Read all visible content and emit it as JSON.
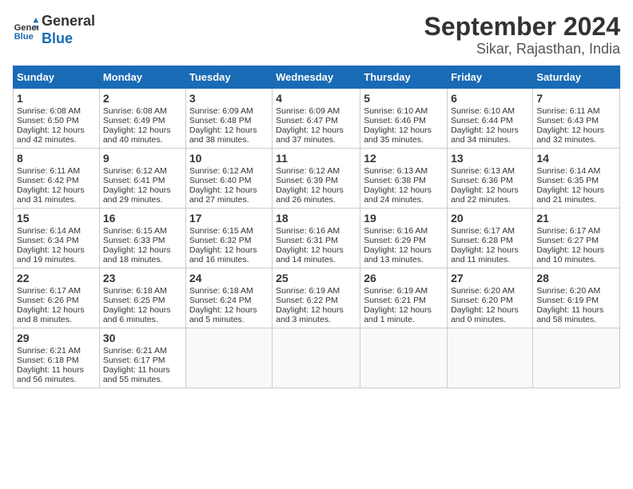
{
  "header": {
    "logo_line1": "General",
    "logo_line2": "Blue",
    "title": "September 2024",
    "subtitle": "Sikar, Rajasthan, India"
  },
  "days_of_week": [
    "Sunday",
    "Monday",
    "Tuesday",
    "Wednesday",
    "Thursday",
    "Friday",
    "Saturday"
  ],
  "weeks": [
    [
      {
        "day": "1",
        "sunrise": "Sunrise: 6:08 AM",
        "sunset": "Sunset: 6:50 PM",
        "daylight": "Daylight: 12 hours and 42 minutes."
      },
      {
        "day": "2",
        "sunrise": "Sunrise: 6:08 AM",
        "sunset": "Sunset: 6:49 PM",
        "daylight": "Daylight: 12 hours and 40 minutes."
      },
      {
        "day": "3",
        "sunrise": "Sunrise: 6:09 AM",
        "sunset": "Sunset: 6:48 PM",
        "daylight": "Daylight: 12 hours and 38 minutes."
      },
      {
        "day": "4",
        "sunrise": "Sunrise: 6:09 AM",
        "sunset": "Sunset: 6:47 PM",
        "daylight": "Daylight: 12 hours and 37 minutes."
      },
      {
        "day": "5",
        "sunrise": "Sunrise: 6:10 AM",
        "sunset": "Sunset: 6:46 PM",
        "daylight": "Daylight: 12 hours and 35 minutes."
      },
      {
        "day": "6",
        "sunrise": "Sunrise: 6:10 AM",
        "sunset": "Sunset: 6:44 PM",
        "daylight": "Daylight: 12 hours and 34 minutes."
      },
      {
        "day": "7",
        "sunrise": "Sunrise: 6:11 AM",
        "sunset": "Sunset: 6:43 PM",
        "daylight": "Daylight: 12 hours and 32 minutes."
      }
    ],
    [
      {
        "day": "8",
        "sunrise": "Sunrise: 6:11 AM",
        "sunset": "Sunset: 6:42 PM",
        "daylight": "Daylight: 12 hours and 31 minutes."
      },
      {
        "day": "9",
        "sunrise": "Sunrise: 6:12 AM",
        "sunset": "Sunset: 6:41 PM",
        "daylight": "Daylight: 12 hours and 29 minutes."
      },
      {
        "day": "10",
        "sunrise": "Sunrise: 6:12 AM",
        "sunset": "Sunset: 6:40 PM",
        "daylight": "Daylight: 12 hours and 27 minutes."
      },
      {
        "day": "11",
        "sunrise": "Sunrise: 6:12 AM",
        "sunset": "Sunset: 6:39 PM",
        "daylight": "Daylight: 12 hours and 26 minutes."
      },
      {
        "day": "12",
        "sunrise": "Sunrise: 6:13 AM",
        "sunset": "Sunset: 6:38 PM",
        "daylight": "Daylight: 12 hours and 24 minutes."
      },
      {
        "day": "13",
        "sunrise": "Sunrise: 6:13 AM",
        "sunset": "Sunset: 6:36 PM",
        "daylight": "Daylight: 12 hours and 22 minutes."
      },
      {
        "day": "14",
        "sunrise": "Sunrise: 6:14 AM",
        "sunset": "Sunset: 6:35 PM",
        "daylight": "Daylight: 12 hours and 21 minutes."
      }
    ],
    [
      {
        "day": "15",
        "sunrise": "Sunrise: 6:14 AM",
        "sunset": "Sunset: 6:34 PM",
        "daylight": "Daylight: 12 hours and 19 minutes."
      },
      {
        "day": "16",
        "sunrise": "Sunrise: 6:15 AM",
        "sunset": "Sunset: 6:33 PM",
        "daylight": "Daylight: 12 hours and 18 minutes."
      },
      {
        "day": "17",
        "sunrise": "Sunrise: 6:15 AM",
        "sunset": "Sunset: 6:32 PM",
        "daylight": "Daylight: 12 hours and 16 minutes."
      },
      {
        "day": "18",
        "sunrise": "Sunrise: 6:16 AM",
        "sunset": "Sunset: 6:31 PM",
        "daylight": "Daylight: 12 hours and 14 minutes."
      },
      {
        "day": "19",
        "sunrise": "Sunrise: 6:16 AM",
        "sunset": "Sunset: 6:29 PM",
        "daylight": "Daylight: 12 hours and 13 minutes."
      },
      {
        "day": "20",
        "sunrise": "Sunrise: 6:17 AM",
        "sunset": "Sunset: 6:28 PM",
        "daylight": "Daylight: 12 hours and 11 minutes."
      },
      {
        "day": "21",
        "sunrise": "Sunrise: 6:17 AM",
        "sunset": "Sunset: 6:27 PM",
        "daylight": "Daylight: 12 hours and 10 minutes."
      }
    ],
    [
      {
        "day": "22",
        "sunrise": "Sunrise: 6:17 AM",
        "sunset": "Sunset: 6:26 PM",
        "daylight": "Daylight: 12 hours and 8 minutes."
      },
      {
        "day": "23",
        "sunrise": "Sunrise: 6:18 AM",
        "sunset": "Sunset: 6:25 PM",
        "daylight": "Daylight: 12 hours and 6 minutes."
      },
      {
        "day": "24",
        "sunrise": "Sunrise: 6:18 AM",
        "sunset": "Sunset: 6:24 PM",
        "daylight": "Daylight: 12 hours and 5 minutes."
      },
      {
        "day": "25",
        "sunrise": "Sunrise: 6:19 AM",
        "sunset": "Sunset: 6:22 PM",
        "daylight": "Daylight: 12 hours and 3 minutes."
      },
      {
        "day": "26",
        "sunrise": "Sunrise: 6:19 AM",
        "sunset": "Sunset: 6:21 PM",
        "daylight": "Daylight: 12 hours and 1 minute."
      },
      {
        "day": "27",
        "sunrise": "Sunrise: 6:20 AM",
        "sunset": "Sunset: 6:20 PM",
        "daylight": "Daylight: 12 hours and 0 minutes."
      },
      {
        "day": "28",
        "sunrise": "Sunrise: 6:20 AM",
        "sunset": "Sunset: 6:19 PM",
        "daylight": "Daylight: 11 hours and 58 minutes."
      }
    ],
    [
      {
        "day": "29",
        "sunrise": "Sunrise: 6:21 AM",
        "sunset": "Sunset: 6:18 PM",
        "daylight": "Daylight: 11 hours and 56 minutes."
      },
      {
        "day": "30",
        "sunrise": "Sunrise: 6:21 AM",
        "sunset": "Sunset: 6:17 PM",
        "daylight": "Daylight: 11 hours and 55 minutes."
      },
      null,
      null,
      null,
      null,
      null
    ]
  ]
}
